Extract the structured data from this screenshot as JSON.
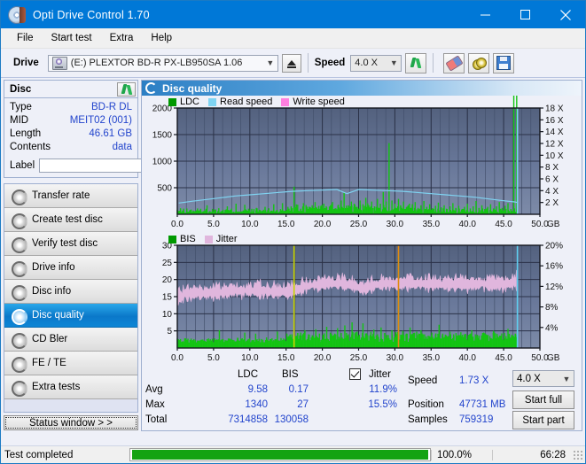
{
  "window": {
    "title": "Opti Drive Control 1.70",
    "icon": "disc-icon",
    "minimize": "minimize",
    "maximize": "maximize",
    "close": "close"
  },
  "menu": [
    {
      "label": "File"
    },
    {
      "label": "Start test"
    },
    {
      "label": "Extra"
    },
    {
      "label": "Help"
    }
  ],
  "drivebar": {
    "drive_label": "Drive",
    "drive_value": "(E:)   PLEXTOR BD-R  PX-LB950SA 1.06",
    "eject": "eject-icon",
    "speed_label": "Speed",
    "speed_value": "4.0 X",
    "refresh": "refresh-icon",
    "erase": "eraser-icon",
    "disc_tools": "discs-icon",
    "save": "save-icon"
  },
  "disc": {
    "title": "Disc",
    "refresh": "refresh-icon",
    "rows": [
      {
        "key": "Type",
        "value": "BD-R DL"
      },
      {
        "key": "MID",
        "value": "MEIT02 (001)"
      },
      {
        "key": "Length",
        "value": "46.61 GB"
      },
      {
        "key": "Contents",
        "value": "data"
      }
    ],
    "label_key": "Label",
    "label_value": "",
    "label_placeholder": ""
  },
  "nav": {
    "items": [
      {
        "label": "Transfer rate",
        "selected": false
      },
      {
        "label": "Create test disc",
        "selected": false
      },
      {
        "label": "Verify test disc",
        "selected": false
      },
      {
        "label": "Drive info",
        "selected": false
      },
      {
        "label": "Disc info",
        "selected": false
      },
      {
        "label": "Disc quality",
        "selected": true
      },
      {
        "label": "CD Bler",
        "selected": false
      },
      {
        "label": "FE / TE",
        "selected": false
      },
      {
        "label": "Extra tests",
        "selected": false
      }
    ],
    "status_window": "Status window > >"
  },
  "panel": {
    "title": "Disc quality"
  },
  "stats": {
    "col_ldc": "LDC",
    "col_bis": "BIS",
    "jitter_label": "Jitter",
    "jitter_checked": true,
    "row_avg": "Avg",
    "row_max": "Max",
    "row_total": "Total",
    "ldc_avg": "9.58",
    "ldc_max": "1340",
    "ldc_total": "7314858",
    "bis_avg": "0.17",
    "bis_max": "27",
    "bis_total": "130058",
    "jitter_avg": "11.9%",
    "jitter_max": "15.5%",
    "speed_label": "Speed",
    "speed_value": "1.73 X",
    "position_label": "Position",
    "position_value": "47731 MB",
    "samples_label": "Samples",
    "samples_value": "759319",
    "speed_select": "4.0 X",
    "start_full": "Start full",
    "start_part": "Start part"
  },
  "statusbar": {
    "message": "Test completed",
    "percent_label": "100.0%",
    "percent": 100,
    "elapsed": "66:28"
  },
  "colors": {
    "accent": "#0078d7",
    "ldc_green": "#13c413",
    "bis_green": "#13c413",
    "read_speed": "#7fd4f2",
    "write_speed": "#ff7fe0",
    "jitter_pink": "#e0b6dd",
    "plot_bg": "#5f6e8c",
    "value_blue": "#2244cc",
    "progress_green": "#14a312"
  },
  "chart_data": [
    {
      "type": "line",
      "id": "ldc-chart",
      "title": "",
      "legend": [
        {
          "label": "LDC",
          "color": "#009900"
        },
        {
          "label": "Read speed",
          "color": "#7fd4f2"
        },
        {
          "label": "Write speed",
          "color": "#ff7fe0"
        }
      ],
      "legend_position": "top-left",
      "xlabel": "GB",
      "xlim": [
        0,
        50
      ],
      "xticks": [
        "0.0",
        "5.0",
        "10.0",
        "15.0",
        "20.0",
        "25.0",
        "30.0",
        "35.0",
        "40.0",
        "45.0",
        "50.0"
      ],
      "ylabel": "",
      "ylim": [
        0,
        2000
      ],
      "yticks": [
        "500",
        "1000",
        "1500",
        "2000"
      ],
      "y2label": "",
      "y2lim": [
        0,
        18
      ],
      "y2ticks": [
        "2 X",
        "4 X",
        "6 X",
        "8 X",
        "10 X",
        "12 X",
        "14 X",
        "16 X",
        "18 X"
      ],
      "grid": true,
      "series": [
        {
          "name": "LDC",
          "kind": "impulse",
          "color": "#13c413",
          "x": [
            0.2,
            0.5,
            0.9,
            1.3,
            1.7,
            2.1,
            2.5,
            2.9,
            3.3,
            3.7,
            4.1,
            4.5,
            4.9,
            5.3,
            5.7,
            6.1,
            6.5,
            6.9,
            7.3,
            7.7,
            8.1,
            8.5,
            8.9,
            9.3,
            9.7,
            10.1,
            10.5,
            10.9,
            11.3,
            11.7,
            12.1,
            12.5,
            12.9,
            13.3,
            13.7,
            14.1,
            14.5,
            14.9,
            15.3,
            15.7,
            16.1,
            16.3,
            16.6,
            17.0,
            17.4,
            17.8,
            18.2,
            18.6,
            19.0,
            19.4,
            19.8,
            20.2,
            20.6,
            21.0,
            21.4,
            21.8,
            22.2,
            22.6,
            23.0,
            23.4,
            23.6,
            24.0,
            24.4,
            24.8,
            25.2,
            25.6,
            26.0,
            26.4,
            26.8,
            27.2,
            27.6,
            28.0,
            28.4,
            28.8,
            29.2,
            29.6,
            30.0,
            30.4,
            30.5,
            30.8,
            31.2,
            31.6,
            32.0,
            32.4,
            32.8,
            33.2,
            33.6,
            34.0,
            34.4,
            34.8,
            35.2,
            35.6,
            36.0,
            36.4,
            36.8,
            37.2,
            37.6,
            38.0,
            38.4,
            38.8,
            39.2,
            39.6,
            40.0,
            40.4,
            40.8,
            41.2,
            41.6,
            42.0,
            42.4,
            42.8,
            43.2,
            43.6,
            44.0,
            44.4,
            44.8,
            45.2,
            45.6,
            46.0,
            46.4,
            46.8
          ],
          "y": [
            60,
            40,
            55,
            35,
            70,
            45,
            60,
            38,
            52,
            44,
            170,
            60,
            48,
            90,
            55,
            42,
            38,
            150,
            60,
            44,
            200,
            55,
            48,
            180,
            62,
            42,
            58,
            120,
            70,
            48,
            140,
            60,
            44,
            190,
            80,
            52,
            210,
            70,
            58,
            150,
            520,
            120,
            180,
            90,
            210,
            140,
            100,
            170,
            230,
            90,
            160,
            200,
            130,
            95,
            230,
            110,
            180,
            260,
            420,
            120,
            170,
            240,
            200,
            140,
            260,
            190,
            310,
            170,
            240,
            150,
            290,
            200,
            420,
            240,
            1340,
            260,
            200,
            150,
            290,
            170,
            240,
            130,
            200,
            160,
            230,
            120,
            170,
            250,
            140,
            190,
            110,
            160,
            220,
            130,
            170,
            100,
            150,
            210,
            120,
            160,
            90,
            140,
            200,
            110,
            150,
            250,
            120,
            170,
            100,
            140,
            190,
            110,
            150,
            230,
            120,
            160,
            210,
            100
          ]
        },
        {
          "name": "Read speed",
          "kind": "line",
          "color": "#7fd4f2",
          "axis": "y2",
          "x": [
            0.2,
            2,
            4,
            6,
            8,
            10,
            12,
            14,
            16,
            18,
            20,
            22,
            23.4,
            25,
            27,
            29,
            31,
            33,
            35,
            37,
            39,
            41,
            43,
            45,
            46.5,
            46.9,
            46.9
          ],
          "y": [
            1.9,
            2.2,
            2.5,
            2.8,
            3.1,
            3.3,
            3.5,
            3.7,
            3.9,
            4.0,
            4.1,
            4.2,
            3.5,
            4.2,
            4.1,
            4.0,
            3.9,
            3.7,
            3.5,
            3.3,
            3.1,
            2.9,
            2.6,
            2.3,
            2.1,
            2.0,
            18.0
          ]
        }
      ],
      "markers": [
        {
          "type": "vline",
          "x": 46.9,
          "color": "#7fd4f2"
        }
      ]
    },
    {
      "type": "line",
      "id": "bis-chart",
      "title": "",
      "legend": [
        {
          "label": "BIS",
          "color": "#009900"
        },
        {
          "label": "Jitter",
          "color": "#e0b6dd"
        }
      ],
      "legend_position": "top-left",
      "xlabel": "GB",
      "xlim": [
        0,
        50
      ],
      "xticks": [
        "0.0",
        "5.0",
        "10.0",
        "15.0",
        "20.0",
        "25.0",
        "30.0",
        "35.0",
        "40.0",
        "45.0",
        "50.0"
      ],
      "ylim": [
        0,
        30
      ],
      "yticks": [
        "5",
        "10",
        "15",
        "20",
        "25",
        "30"
      ],
      "y2lim": [
        0,
        20
      ],
      "y2ticks": [
        "4%",
        "8%",
        "12%",
        "16%",
        "20%"
      ],
      "grid": true,
      "series": [
        {
          "name": "BIS",
          "kind": "impulse",
          "color": "#13c413",
          "x": [
            0.3,
            0.8,
            1.3,
            1.8,
            2.3,
            2.8,
            3.3,
            3.8,
            4.3,
            4.8,
            5.3,
            5.8,
            6.3,
            6.8,
            7.3,
            7.8,
            8.3,
            8.8,
            9.3,
            9.8,
            10.3,
            10.8,
            11.3,
            11.8,
            12.3,
            12.8,
            13.3,
            13.8,
            14.3,
            14.8,
            15.3,
            15.8,
            16.1,
            16.6,
            17.1,
            17.6,
            18.1,
            18.6,
            19.1,
            19.6,
            20.1,
            20.6,
            21.1,
            21.6,
            22.1,
            22.6,
            23.1,
            23.6,
            24.1,
            24.6,
            25.1,
            25.6,
            26.1,
            26.6,
            27.1,
            27.6,
            28.1,
            28.6,
            29.1,
            29.6,
            30.1,
            30.5,
            31.1,
            31.6,
            32.1,
            32.6,
            33.1,
            33.6,
            34.1,
            34.6,
            35.1,
            35.6,
            36.1,
            36.6,
            37.1,
            37.6,
            38.1,
            38.6,
            39.1,
            39.6,
            40.1,
            40.6,
            41.1,
            41.6,
            42.1,
            42.6,
            43.1,
            43.6,
            44.1,
            44.6,
            45.1,
            45.6,
            46.1,
            46.6
          ],
          "y": [
            2.2,
            2.0,
            2.3,
            2.1,
            2.6,
            2.2,
            2.4,
            2.1,
            2.8,
            2.3,
            2.1,
            5.2,
            2.4,
            2.2,
            2.7,
            2.3,
            3.0,
            2.5,
            4.5,
            2.6,
            2.3,
            4.2,
            2.7,
            2.4,
            3.1,
            2.6,
            2.3,
            4.8,
            2.9,
            2.5,
            3.3,
            4.0,
            13.0,
            4.4,
            3.6,
            5.2,
            4.0,
            3.5,
            5.5,
            4.2,
            3.8,
            6.2,
            4.5,
            3.8,
            5.8,
            4.4,
            6.6,
            4.0,
            7.5,
            4.6,
            3.9,
            7.2,
            4.3,
            3.8,
            5.4,
            4.0,
            6.0,
            4.4,
            3.8,
            5.2,
            4.6,
            27.0,
            5.0,
            4.2,
            6.0,
            4.4,
            3.8,
            5.2,
            4.0,
            3.6,
            4.5,
            3.9,
            6.8,
            4.2,
            3.7,
            4.8,
            4.0,
            3.6,
            4.6,
            4.0,
            3.5,
            5.2,
            4.0,
            3.6,
            4.4,
            3.9,
            3.5,
            5.0,
            4.1,
            3.6,
            4.4,
            5.6,
            3.8,
            4.2
          ]
        },
        {
          "name": "Jitter",
          "kind": "band",
          "color": "#e0b6dd",
          "x": [
            0.2,
            1,
            2,
            3,
            4,
            5,
            6,
            7,
            8,
            9,
            10,
            11,
            12,
            13,
            14,
            15,
            16,
            17,
            18,
            19,
            20,
            21,
            22,
            23,
            24,
            25,
            26,
            27,
            28,
            29,
            30,
            31,
            32,
            33,
            34,
            35,
            36,
            37,
            38,
            39,
            40,
            41,
            42,
            43,
            44,
            45,
            46,
            46.8
          ],
          "y": [
            14.6,
            15.6,
            15.9,
            16.0,
            16.1,
            16.2,
            16.3,
            16.5,
            16.6,
            16.6,
            16.7,
            16.8,
            16.7,
            16.5,
            16.4,
            16.4,
            16.6,
            17.4,
            18.1,
            18.5,
            18.8,
            19.0,
            18.9,
            18.7,
            18.2,
            17.6,
            17.3,
            18.4,
            18.6,
            18.7,
            18.7,
            18.9,
            19.0,
            18.8,
            18.7,
            18.6,
            18.6,
            18.6,
            18.7,
            18.7,
            18.6,
            18.6,
            18.7,
            18.7,
            18.7,
            18.8,
            18.9,
            19.3
          ],
          "spread": 1.6
        }
      ],
      "markers": [
        {
          "type": "vline",
          "x": 16.1,
          "color": "#c8d400"
        },
        {
          "type": "vline",
          "x": 30.5,
          "color": "#e08a10"
        },
        {
          "type": "vline",
          "x": 46.9,
          "color": "#5fd0f2"
        }
      ]
    }
  ]
}
